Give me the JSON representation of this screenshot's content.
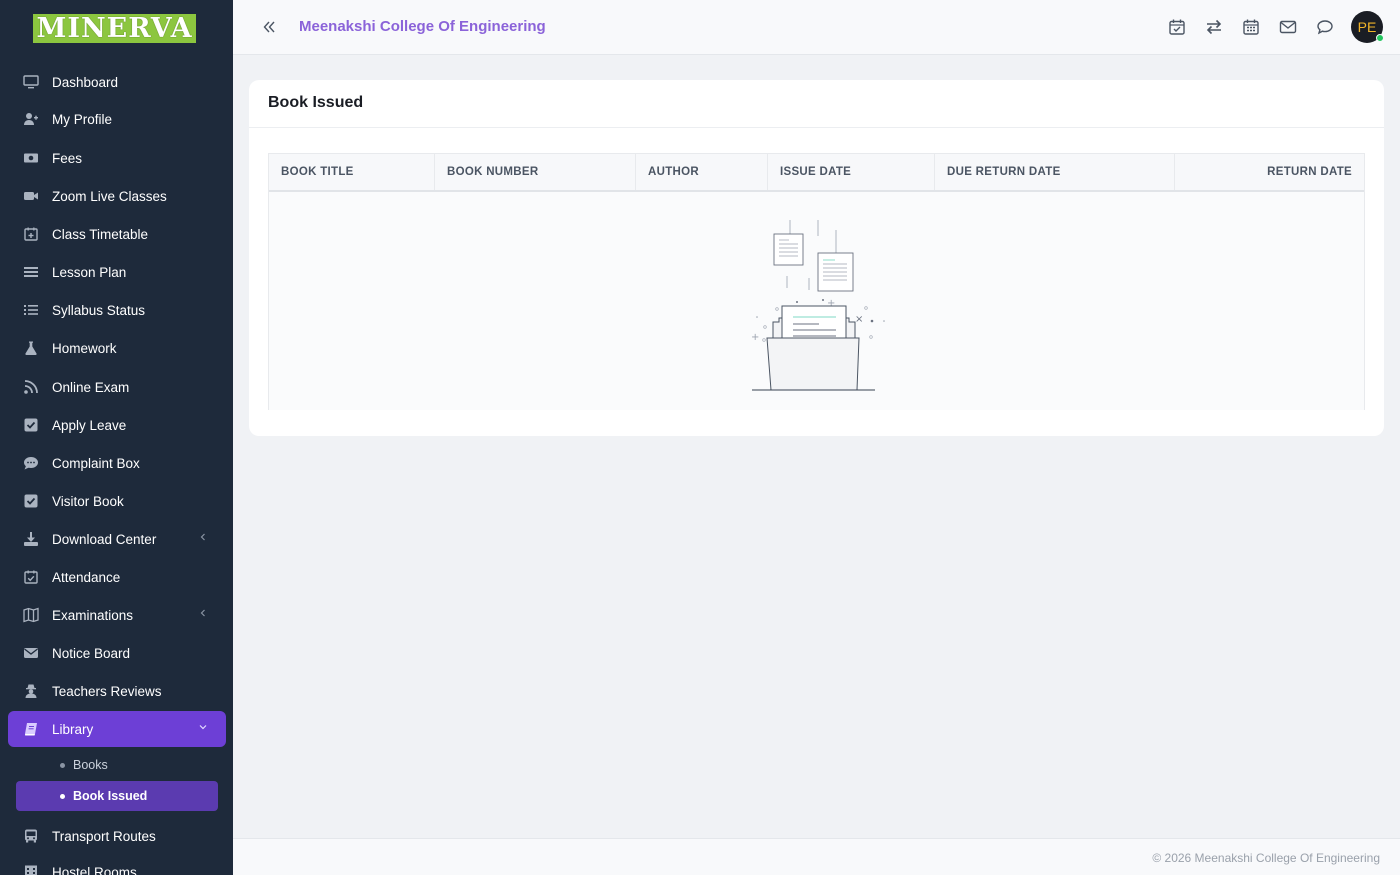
{
  "brand": {
    "logo_text": "MINERVA"
  },
  "sidebar": {
    "items": [
      {
        "label": "Dashboard",
        "icon": "monitor-icon"
      },
      {
        "label": "My Profile",
        "icon": "user-plus-icon"
      },
      {
        "label": "Fees",
        "icon": "money-icon"
      },
      {
        "label": "Zoom Live Classes",
        "icon": "video-icon"
      },
      {
        "label": "Class Timetable",
        "icon": "calendar-plus-icon"
      },
      {
        "label": "Lesson Plan",
        "icon": "list-icon"
      },
      {
        "label": "Syllabus Status",
        "icon": "list-check-icon"
      },
      {
        "label": "Homework",
        "icon": "flask-icon"
      },
      {
        "label": "Online Exam",
        "icon": "rss-icon"
      },
      {
        "label": "Apply Leave",
        "icon": "check-square-icon"
      },
      {
        "label": "Complaint Box",
        "icon": "chat-icon"
      },
      {
        "label": "Visitor Book",
        "icon": "check-square-icon"
      },
      {
        "label": "Download Center",
        "icon": "download-icon"
      },
      {
        "label": "Attendance",
        "icon": "calendar-check-icon"
      },
      {
        "label": "Examinations",
        "icon": "map-icon"
      },
      {
        "label": "Notice Board",
        "icon": "envelope-icon"
      },
      {
        "label": "Teachers Reviews",
        "icon": "user-secret-icon"
      },
      {
        "label": "Library",
        "icon": "book-icon"
      },
      {
        "label": "Transport Routes",
        "icon": "bus-icon"
      },
      {
        "label": "Hostel Rooms",
        "icon": "building-icon"
      }
    ],
    "library_sub": [
      {
        "label": "Books"
      },
      {
        "label": "Book Issued"
      }
    ]
  },
  "topbar": {
    "college_name": "Meenakshi College Of Engineering",
    "avatar_initials": "PE",
    "icons": [
      "calendar-check-icon",
      "exchange-icon",
      "calendar-icon",
      "envelope-icon",
      "chat-bubble-icon"
    ]
  },
  "card": {
    "title": "Book Issued",
    "columns": [
      "BOOK TITLE",
      "BOOK NUMBER",
      "AUTHOR",
      "ISSUE DATE",
      "DUE RETURN DATE",
      "RETURN DATE"
    ],
    "rows": []
  },
  "footer": {
    "text": "© 2026 Meenakshi College Of Engineering"
  },
  "colors": {
    "sidebar_bg": "#1e2a3b",
    "accent": "#6d3fd6",
    "brand_logo": "#8cc63f",
    "college_name": "#8b63d9"
  }
}
